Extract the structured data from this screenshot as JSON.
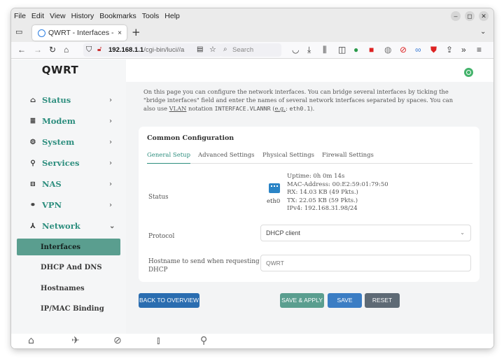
{
  "menubar": {
    "items": [
      {
        "label": "File"
      },
      {
        "label": "Edit"
      },
      {
        "label": "View"
      },
      {
        "label": "History"
      },
      {
        "label": "Bookmarks"
      },
      {
        "label": "Tools"
      },
      {
        "label": "Help"
      }
    ],
    "window_controls": [
      "–",
      "◻",
      "✕"
    ]
  },
  "tabbar": {
    "tab_title": "QWRT - Interfaces - LuCI",
    "close_glyph": "×",
    "newtab_glyph": "+",
    "overflow_glyph": "⌄"
  },
  "navbar": {
    "url_host": "192.168.1.1",
    "url_path": "/cgi-bin/luci//a",
    "search_placeholder": "Search"
  },
  "sidebar": {
    "brand": "QWRT",
    "items": [
      {
        "label": "Status",
        "icon": "home-icon"
      },
      {
        "label": "Modem",
        "icon": "database-icon"
      },
      {
        "label": "System",
        "icon": "gear-icon"
      },
      {
        "label": "Services",
        "icon": "user-icon"
      },
      {
        "label": "NAS",
        "icon": "drive-icon"
      },
      {
        "label": "VPN",
        "icon": "link-icon"
      },
      {
        "label": "Network",
        "icon": "sitemap-icon"
      }
    ],
    "subitems": [
      {
        "label": "Interfaces",
        "active": true
      },
      {
        "label": "DHCP And DNS",
        "active": false
      },
      {
        "label": "Hostnames",
        "active": false
      },
      {
        "label": "IP/MAC Binding",
        "active": false
      }
    ]
  },
  "main": {
    "description_1": "On this page you can configure the network interfaces. You can bridge several interfaces by ticking the \"bridge interfaces\" field and enter the names of several network interfaces separated by spaces. You can also use ",
    "description_vlan": "VLAN",
    "description_2": " notation ",
    "description_code1": "INTERFACE.VLANNR",
    "description_3": " (",
    "description_eg": "e.g.",
    "description_4": ": ",
    "description_code2": "eth0.1",
    "description_5": ").",
    "card_title": "Common Configuration",
    "tabs": [
      {
        "label": "General Setup",
        "active": true
      },
      {
        "label": "Advanced Settings",
        "active": false
      },
      {
        "label": "Physical Settings",
        "active": false
      },
      {
        "label": "Firewall Settings",
        "active": false
      }
    ],
    "status_label": "Status",
    "status_ifname": "eth0",
    "status_lines": [
      "Uptime: 0h 0m 14s",
      "MAC-Address: 00:E2:59:01:79:50",
      "RX: 14.03 KB (49 Pkts.)",
      "TX: 22.05 KB (59 Pkts.)",
      "IPv4: 192.168.31.98/24"
    ],
    "protocol_label": "Protocol",
    "protocol_value": "DHCP client",
    "hostname_label_1": "Hostname to send when requesting",
    "hostname_label_2": "DHCP",
    "hostname_placeholder": "QWRT"
  },
  "actions": {
    "back": "BACK TO OVERVIEW",
    "save_apply": "SAVE & APPLY",
    "save": "SAVE",
    "reset": "RESET"
  },
  "colors": {
    "accent": "#2d8e7e",
    "active_nav_bg": "#5a9e8f",
    "button_blue": "#2a6db0",
    "button_reset": "#5e6a75"
  }
}
